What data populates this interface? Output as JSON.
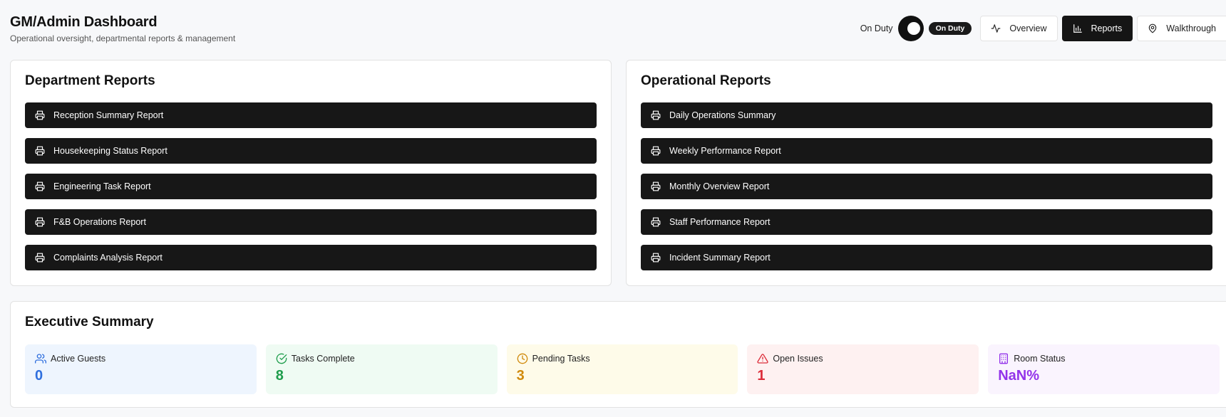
{
  "header": {
    "title": "GM/Admin Dashboard",
    "subtitle": "Operational oversight, departmental reports & management"
  },
  "toolbar": {
    "on_duty_label": "On Duty",
    "on_duty_badge": "On Duty",
    "buttons": [
      {
        "label": "Overview",
        "icon": "activity-icon",
        "active": false
      },
      {
        "label": "Reports",
        "icon": "bar-chart-icon",
        "active": true
      },
      {
        "label": "Walkthrough",
        "icon": "map-pin-icon",
        "active": false
      }
    ]
  },
  "department_reports": {
    "title": "Department Reports",
    "items": [
      "Reception Summary Report",
      "Housekeeping Status Report",
      "Engineering Task Report",
      "F&B Operations Report",
      "Complaints Analysis Report"
    ]
  },
  "operational_reports": {
    "title": "Operational Reports",
    "items": [
      "Daily Operations Summary",
      "Weekly Performance Report",
      "Monthly Overview Report",
      "Staff Performance Report",
      "Incident Summary Report"
    ]
  },
  "executive_summary": {
    "title": "Executive Summary",
    "stats": [
      {
        "label": "Active Guests",
        "value": "0",
        "icon": "users-icon",
        "color": "#2f6fde",
        "bg": "#eef5fe"
      },
      {
        "label": "Tasks Complete",
        "value": "8",
        "icon": "check-circle-icon",
        "color": "#1f9d4c",
        "bg": "#effbf3"
      },
      {
        "label": "Pending Tasks",
        "value": "3",
        "icon": "clock-icon",
        "color": "#d08a0c",
        "bg": "#fefbe9"
      },
      {
        "label": "Open Issues",
        "value": "1",
        "icon": "alert-triangle-icon",
        "color": "#dc2d3a",
        "bg": "#fef1f1"
      },
      {
        "label": "Room Status",
        "value": "NaN%",
        "icon": "building-icon",
        "color": "#9333ea",
        "bg": "#faf4fe"
      }
    ]
  }
}
